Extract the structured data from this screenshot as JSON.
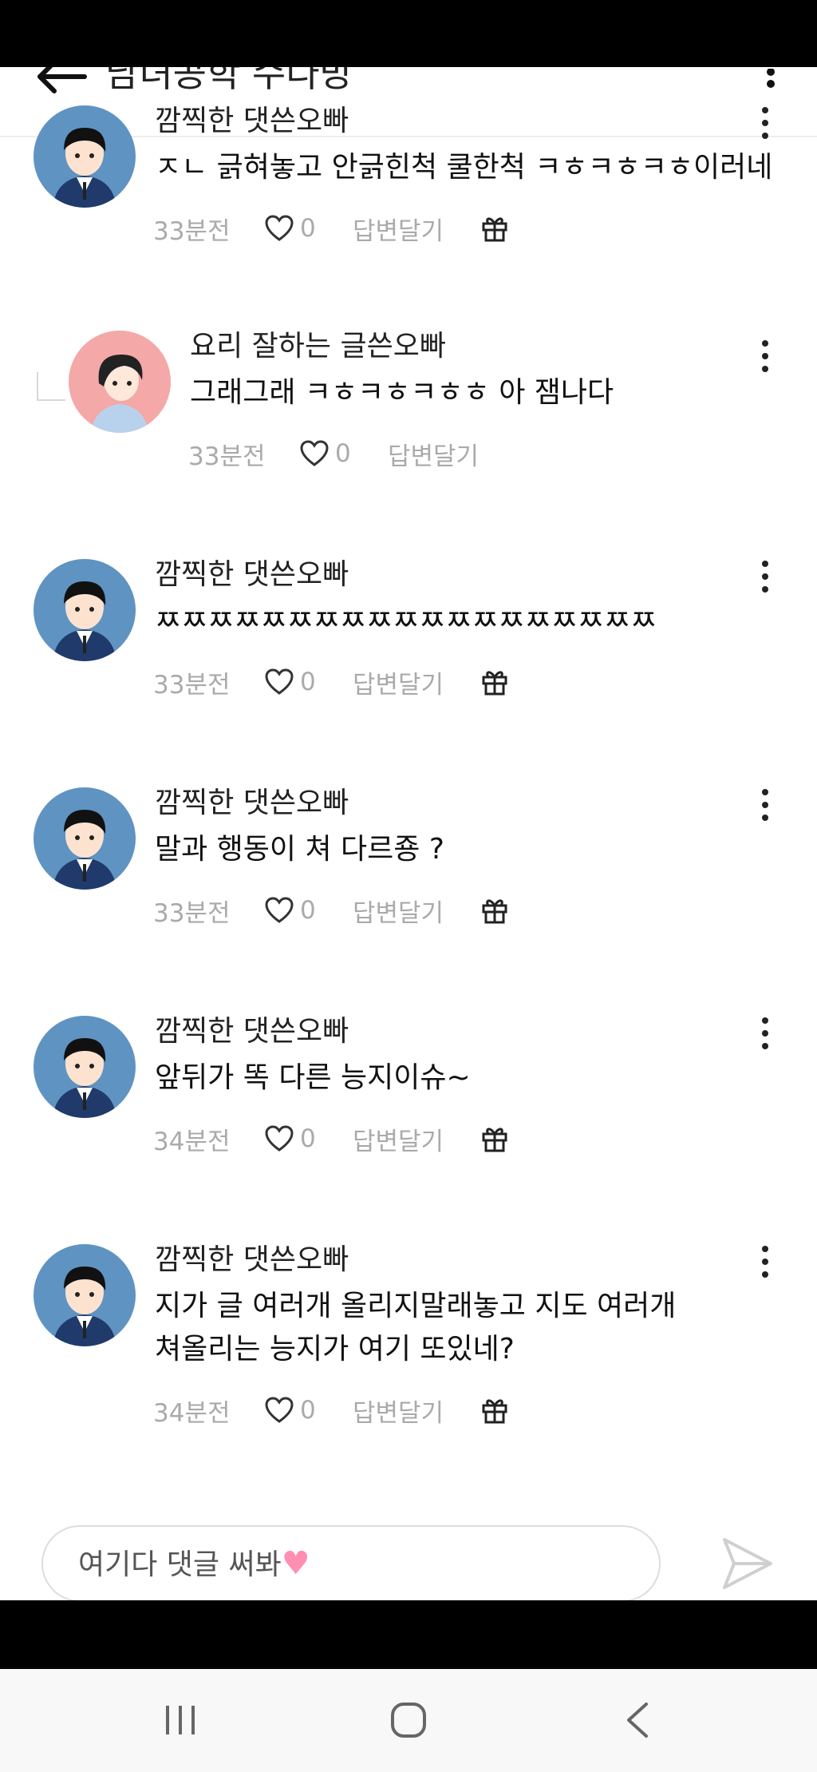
{
  "header": {
    "title": "남녀공학 수다방",
    "back_icon": "arrow-left-icon",
    "more_icon": "vertical-ellipsis-icon"
  },
  "comments": [
    {
      "author": "깜찍한 댓쓴오빠",
      "text": [
        "ㅈㄴ 긁혀놓고 안긁힌척 쿨한척 ㅋㅎㅋㅎㅋㅎ이러네"
      ],
      "time": "33분전",
      "likes": "0",
      "reply_label": "답변달기",
      "has_gift": true,
      "is_reply": false
    },
    {
      "author": "요리 잘하는 글쓴오빠",
      "text": [
        "그래그래 ㅋㅎㅋㅎㅋㅎㅎ 아 잼나다"
      ],
      "time": "33분전",
      "likes": "0",
      "reply_label": "답변달기",
      "has_gift": false,
      "is_reply": true
    },
    {
      "author": "깜찍한 댓쓴오빠",
      "text": [
        "ㅉㅉㅉㅉㅉㅉㅉㅉㅉㅉㅉㅉㅉㅉㅉㅉㅉㅉㅉ"
      ],
      "time": "33분전",
      "likes": "0",
      "reply_label": "답변달기",
      "has_gift": true,
      "is_reply": false
    },
    {
      "author": "깜찍한 댓쓴오빠",
      "text": [
        "말과 행동이 쳐 다르죵 ?"
      ],
      "time": "33분전",
      "likes": "0",
      "reply_label": "답변달기",
      "has_gift": true,
      "is_reply": false
    },
    {
      "author": "깜찍한 댓쓴오빠",
      "text": [
        "앞뒤가 똑 다른 능지이슈~"
      ],
      "time": "34분전",
      "likes": "0",
      "reply_label": "답변달기",
      "has_gift": true,
      "is_reply": false
    },
    {
      "author": "깜찍한 댓쓴오빠",
      "text": [
        "지가 글 여러개 올리지말래놓고 지도 여러개",
        "쳐올리는 능지가 여기 또있네?"
      ],
      "time": "34분전",
      "likes": "0",
      "reply_label": "답변달기",
      "has_gift": true,
      "is_reply": false
    }
  ],
  "input": {
    "placeholder": "여기다 댓글 써봐",
    "emoji": "♥",
    "send_icon": "send-icon"
  },
  "colors": {
    "avatar_boy_bg": "#5f93c2",
    "avatar_girl_bg": "#f4a8a8",
    "meta_gray": "#aaaaaa",
    "heart_pink": "#ff8fb0"
  },
  "navbar": {
    "icons": [
      "recent-apps-icon",
      "home-icon",
      "back-icon"
    ]
  }
}
